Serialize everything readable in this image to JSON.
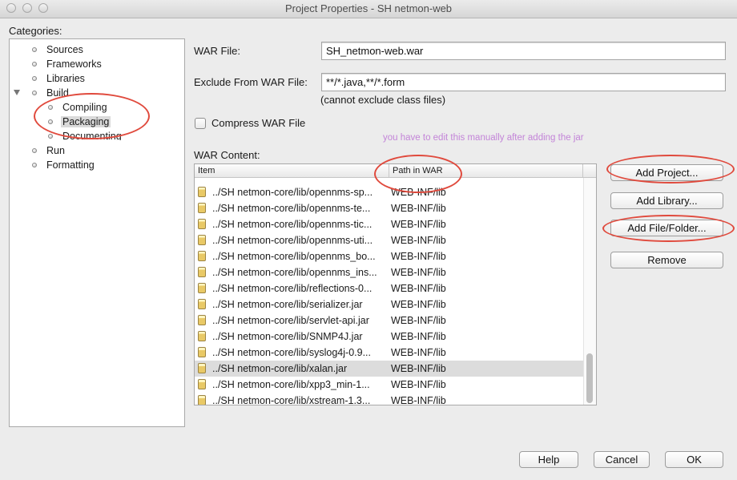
{
  "window": {
    "title": "Project Properties - SH netmon-web"
  },
  "categories": {
    "label": "Categories:",
    "items": [
      {
        "label": "Sources"
      },
      {
        "label": "Frameworks"
      },
      {
        "label": "Libraries"
      },
      {
        "label": "Build"
      },
      {
        "label": "Compiling"
      },
      {
        "label": "Packaging"
      },
      {
        "label": "Documenting"
      },
      {
        "label": "Run"
      },
      {
        "label": "Formatting"
      }
    ]
  },
  "form": {
    "war_file_label": "WAR File:",
    "war_file_value": "SH_netmon-web.war",
    "exclude_label": "Exclude From WAR File:",
    "exclude_value": "**/*.java,**/*.form",
    "exclude_hint": "(cannot exclude class files)",
    "compress_label": "Compress WAR File",
    "compress_checked": false,
    "war_content_label": "WAR Content:",
    "annotation_note": "you have to edit this manually after adding the jar"
  },
  "table": {
    "columns": [
      "Item",
      "Path in WAR"
    ],
    "rows": [
      {
        "item": "../SH netmon-core/lib/opennms-sp...",
        "path": "WEB-INF/lib"
      },
      {
        "item": "../SH netmon-core/lib/opennms-te...",
        "path": "WEB-INF/lib"
      },
      {
        "item": "../SH netmon-core/lib/opennms-tic...",
        "path": "WEB-INF/lib"
      },
      {
        "item": "../SH netmon-core/lib/opennms-uti...",
        "path": "WEB-INF/lib"
      },
      {
        "item": "../SH netmon-core/lib/opennms_bo...",
        "path": "WEB-INF/lib"
      },
      {
        "item": "../SH netmon-core/lib/opennms_ins...",
        "path": "WEB-INF/lib"
      },
      {
        "item": "../SH netmon-core/lib/reflections-0...",
        "path": "WEB-INF/lib"
      },
      {
        "item": "../SH netmon-core/lib/serializer.jar",
        "path": "WEB-INF/lib"
      },
      {
        "item": "../SH netmon-core/lib/servlet-api.jar",
        "path": "WEB-INF/lib"
      },
      {
        "item": "../SH netmon-core/lib/SNMP4J.jar",
        "path": "WEB-INF/lib"
      },
      {
        "item": "../SH netmon-core/lib/syslog4j-0.9...",
        "path": "WEB-INF/lib"
      },
      {
        "item": "../SH netmon-core/lib/xalan.jar",
        "path": "WEB-INF/lib",
        "selected": true
      },
      {
        "item": "../SH netmon-core/lib/xpp3_min-1...",
        "path": "WEB-INF/lib"
      },
      {
        "item": "../SH netmon-core/lib/xstream-1.3...",
        "path": "WEB-INF/lib"
      }
    ]
  },
  "side_buttons": {
    "add_project": "Add Project...",
    "add_library": "Add Library...",
    "add_file_folder": "Add File/Folder...",
    "remove": "Remove"
  },
  "footer_buttons": {
    "help": "Help",
    "cancel": "Cancel",
    "ok": "OK"
  },
  "colors": {
    "annotation_red": "#e04a3d",
    "annotation_text": "#c384d8",
    "selection_gray": "#dcdcdc"
  }
}
